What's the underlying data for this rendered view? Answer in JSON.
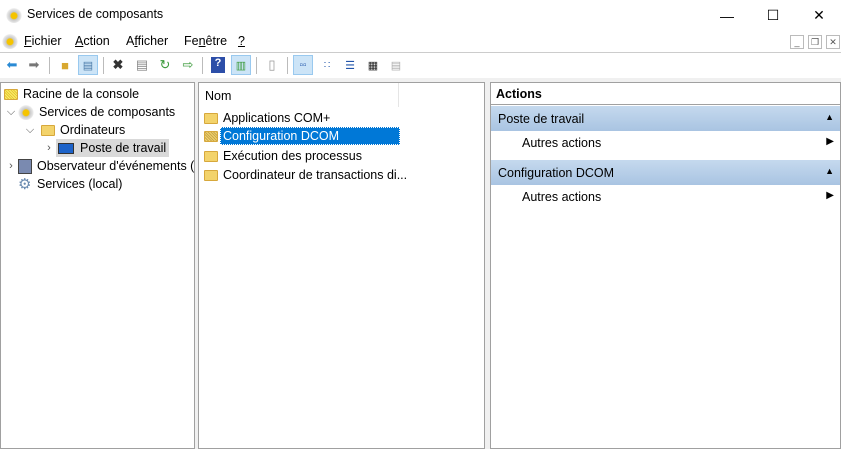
{
  "window": {
    "title": "Services de composants",
    "controls": [
      "minimize",
      "maximize",
      "close"
    ]
  },
  "menu": [
    {
      "label": "Fichier",
      "key": "F"
    },
    {
      "label": "Action",
      "key": "A"
    },
    {
      "label": "Afficher",
      "key": "f"
    },
    {
      "label": "Fenêtre",
      "key": "n"
    },
    {
      "label": "?",
      "key": "?"
    }
  ],
  "toolbar": [
    "back-icon",
    "forward-icon",
    "up-folder-icon",
    "show-hide-tree-icon",
    "delete-icon",
    "properties-icon",
    "refresh-icon",
    "export-list-icon",
    "help-icon",
    "show-hide-action-pane-icon",
    "new-window-icon",
    "large-icons-view-icon",
    "small-icons-view-icon",
    "list-view-icon",
    "detail-view-icon",
    "custom-view-icon"
  ],
  "tree": [
    {
      "label": "Racine de la console",
      "level": 0
    },
    {
      "label": "Services de composants",
      "level": 1,
      "expanded": true
    },
    {
      "label": "Ordinateurs",
      "level": 2,
      "expanded": true
    },
    {
      "label": "Poste de travail",
      "level": 3,
      "selected": true
    },
    {
      "label": "Observateur d'événements (",
      "level": 1
    },
    {
      "label": "Services (local)",
      "level": 1
    }
  ],
  "list": {
    "column": "Nom",
    "items": [
      {
        "label": "Applications COM+"
      },
      {
        "label": "Configuration DCOM",
        "selected": true
      },
      {
        "label": "Exécution des processus"
      },
      {
        "label": "Coordinateur de transactions di..."
      }
    ]
  },
  "actions": {
    "title": "Actions",
    "sections": [
      {
        "title": "Poste de travail",
        "item": "Autres actions"
      },
      {
        "title": "Configuration DCOM",
        "item": "Autres actions"
      }
    ]
  },
  "colors": {
    "selection": "#0078d7",
    "section_header": "#b7cfe8"
  }
}
